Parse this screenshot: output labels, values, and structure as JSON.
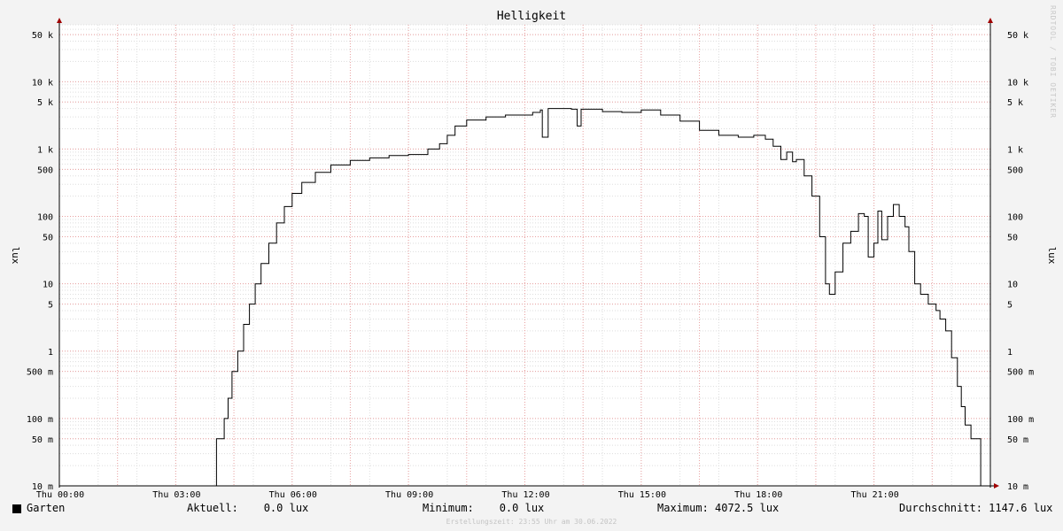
{
  "chart_data": {
    "type": "line",
    "title": "Helligkeit",
    "ylabel": "lux",
    "yscale": "log",
    "ylim": [
      0.01,
      70000
    ],
    "y_ticks": [
      {
        "value": 50000,
        "label": "50 k"
      },
      {
        "value": 10000,
        "label": "10 k"
      },
      {
        "value": 5000,
        "label": "5 k"
      },
      {
        "value": 1000,
        "label": "1 k"
      },
      {
        "value": 500,
        "label": "500"
      },
      {
        "value": 100,
        "label": "100"
      },
      {
        "value": 50,
        "label": "50"
      },
      {
        "value": 10,
        "label": "10"
      },
      {
        "value": 5,
        "label": "5"
      },
      {
        "value": 1,
        "label": "1"
      },
      {
        "value": 0.5,
        "label": "500 m"
      },
      {
        "value": 0.1,
        "label": "100 m"
      },
      {
        "value": 0.05,
        "label": "50 m"
      },
      {
        "value": 0.01,
        "label": "10 m"
      }
    ],
    "x_unit": "hours",
    "xlim": [
      0,
      24
    ],
    "x_ticks": [
      {
        "value": 0,
        "label": "Thu 00:00"
      },
      {
        "value": 3,
        "label": "Thu 03:00"
      },
      {
        "value": 6,
        "label": "Thu 06:00"
      },
      {
        "value": 9,
        "label": "Thu 09:00"
      },
      {
        "value": 12,
        "label": "Thu 12:00"
      },
      {
        "value": 15,
        "label": "Thu 15:00"
      },
      {
        "value": 18,
        "label": "Thu 18:00"
      },
      {
        "value": 21,
        "label": "Thu 21:00"
      }
    ],
    "grid": true,
    "series": [
      {
        "name": "Garten",
        "color": "#000000",
        "points": [
          [
            0,
            0.01
          ],
          [
            4.0,
            0.01
          ],
          [
            4.05,
            0.05
          ],
          [
            4.25,
            0.1
          ],
          [
            4.35,
            0.2
          ],
          [
            4.45,
            0.5
          ],
          [
            4.6,
            1.0
          ],
          [
            4.75,
            2.5
          ],
          [
            4.9,
            5
          ],
          [
            5.05,
            10
          ],
          [
            5.2,
            20
          ],
          [
            5.4,
            40
          ],
          [
            5.6,
            80
          ],
          [
            5.8,
            140
          ],
          [
            6.0,
            220
          ],
          [
            6.25,
            320
          ],
          [
            6.6,
            450
          ],
          [
            7.0,
            580
          ],
          [
            7.5,
            680
          ],
          [
            8.0,
            740
          ],
          [
            8.5,
            800
          ],
          [
            9.0,
            830
          ],
          [
            9.5,
            1000
          ],
          [
            9.8,
            1200
          ],
          [
            10.0,
            1600
          ],
          [
            10.2,
            2200
          ],
          [
            10.5,
            2700
          ],
          [
            11.0,
            3000
          ],
          [
            11.5,
            3200
          ],
          [
            12.2,
            3500
          ],
          [
            12.4,
            3800
          ],
          [
            12.45,
            1500
          ],
          [
            12.6,
            4000
          ],
          [
            13.2,
            3900
          ],
          [
            13.35,
            2200
          ],
          [
            13.45,
            3900
          ],
          [
            14.0,
            3600
          ],
          [
            14.5,
            3500
          ],
          [
            15.0,
            3800
          ],
          [
            15.5,
            3200
          ],
          [
            16.0,
            2600
          ],
          [
            16.5,
            1900
          ],
          [
            17.0,
            1600
          ],
          [
            17.5,
            1500
          ],
          [
            17.9,
            1600
          ],
          [
            18.2,
            1400
          ],
          [
            18.4,
            1100
          ],
          [
            18.6,
            700
          ],
          [
            18.75,
            900
          ],
          [
            18.9,
            650
          ],
          [
            19.0,
            700
          ],
          [
            19.2,
            400
          ],
          [
            19.4,
            200
          ],
          [
            19.6,
            50
          ],
          [
            19.75,
            10
          ],
          [
            19.85,
            7
          ],
          [
            20.0,
            15
          ],
          [
            20.2,
            40
          ],
          [
            20.4,
            60
          ],
          [
            20.6,
            110
          ],
          [
            20.75,
            100
          ],
          [
            20.85,
            25
          ],
          [
            21.0,
            40
          ],
          [
            21.1,
            120
          ],
          [
            21.2,
            45
          ],
          [
            21.35,
            100
          ],
          [
            21.5,
            150
          ],
          [
            21.65,
            100
          ],
          [
            21.8,
            70
          ],
          [
            21.9,
            30
          ],
          [
            22.05,
            10
          ],
          [
            22.2,
            7
          ],
          [
            22.4,
            5
          ],
          [
            22.6,
            4
          ],
          [
            22.7,
            3
          ],
          [
            22.85,
            2
          ],
          [
            23.0,
            0.8
          ],
          [
            23.15,
            0.3
          ],
          [
            23.25,
            0.15
          ],
          [
            23.35,
            0.08
          ],
          [
            23.5,
            0.05
          ],
          [
            23.7,
            0.05
          ],
          [
            23.75,
            0.01
          ],
          [
            24.0,
            0.01
          ]
        ]
      }
    ]
  },
  "legend": {
    "series_name": "Garten",
    "aktuell": "Aktuell:    0.0 lux",
    "minimum": "Minimum:    0.0 lux",
    "maximum": "Maximum: 4072.5 lux",
    "durchschnitt": "Durchschnitt: 1147.6 lux"
  },
  "footer": {
    "credit": "Erstellungszeit: 23:55 Uhr am 30.06.2022",
    "watermark": "RRDTOOL / TOBI OETIKER"
  }
}
